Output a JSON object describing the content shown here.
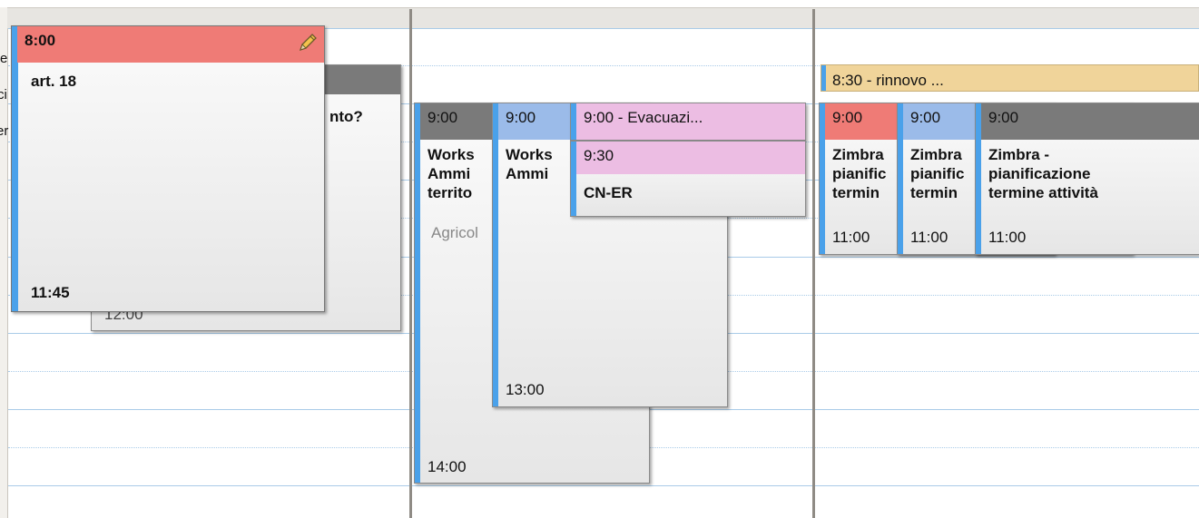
{
  "colors": {
    "accent_bar": "#4aa1ea",
    "red_header": "#ef7b76",
    "blue_header": "#9bbbe9",
    "pink_header": "#ecbde3",
    "gray_header": "#7a7a7a",
    "allday": "#f0d49a"
  },
  "sidebar": {
    "partial_letters": [
      "e",
      "ci",
      "er"
    ]
  },
  "day1": {
    "back_appt": {
      "title_fragment": "nto?",
      "end": "12:00"
    },
    "front_appt": {
      "start": "8:00",
      "title": "art. 18",
      "end": "11:45",
      "edit_icon": "pencil-icon"
    }
  },
  "day2": {
    "appt_a": {
      "start": "9:00",
      "title_lines": [
        "Works",
        "Ammi",
        "territo"
      ],
      "location": "Agricol",
      "end": "14:00"
    },
    "appt_b": {
      "start": "9:00",
      "title_lines": [
        "Works",
        "Ammi"
      ],
      "end": "13:00"
    },
    "appt_c": {
      "header": "9:00 - Evacuazi..."
    },
    "appt_d": {
      "start": "9:30",
      "title": "CN-ER"
    }
  },
  "day3": {
    "allday": {
      "label": "8:30 - rinnovo ..."
    },
    "appt_a": {
      "start": "9:00",
      "title_lines": [
        "Zimbra",
        "pianific",
        "termin"
      ],
      "end": "11:00"
    },
    "appt_b": {
      "start": "9:00",
      "title_lines": [
        "Zimbra",
        "pianific",
        "termin"
      ],
      "end": "11:00"
    },
    "appt_c": {
      "start": "9:00",
      "title_lines": [
        "Zimbra -",
        "pianificazione",
        "termine attività"
      ],
      "end": "11:00"
    }
  }
}
